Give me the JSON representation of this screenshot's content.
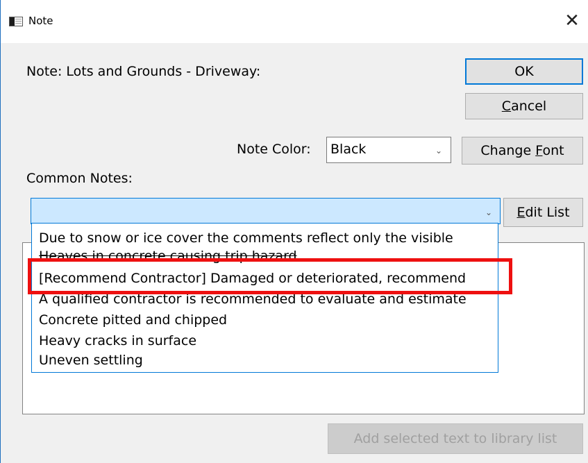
{
  "window": {
    "title": "Note",
    "close_glyph": "✕"
  },
  "note_label": "Note: Lots and Grounds - Driveway:",
  "buttons": {
    "ok": "OK",
    "cancel_prefix": "",
    "cancel_underlined": "C",
    "cancel_rest": "ancel",
    "change_font_prefix": "Change ",
    "change_font_underlined": "F",
    "change_font_rest": "ont",
    "edit_list_prefix": "",
    "edit_list_underlined": "E",
    "edit_list_rest": "dit List",
    "add_selected": "Add selected text to library list"
  },
  "note_color": {
    "label": "Note Color:",
    "value": "Black"
  },
  "common_notes": {
    "label": "Common Notes:",
    "value": "",
    "items": [
      "Due to snow or ice cover the comments reflect only the visible",
      "Heaves in concrete causing trip hazard",
      "[Recommend Contractor] Damaged or deteriorated, recommend",
      "A qualified contractor is recommended to evaluate and estimate",
      "Concrete pitted and chipped",
      "Heavy cracks in surface",
      "Uneven settling"
    ]
  },
  "icons": {
    "window": "window-app-icon",
    "close": "close-icon",
    "chevron": "chevron-down-icon",
    "scroll_up": "scroll-up-arrow",
    "scroll_down": "scroll-down-arrow"
  },
  "colors": {
    "accent": "#0078d7",
    "highlight_box": "#ee1010",
    "dialog_bg": "#f0f0f0"
  }
}
